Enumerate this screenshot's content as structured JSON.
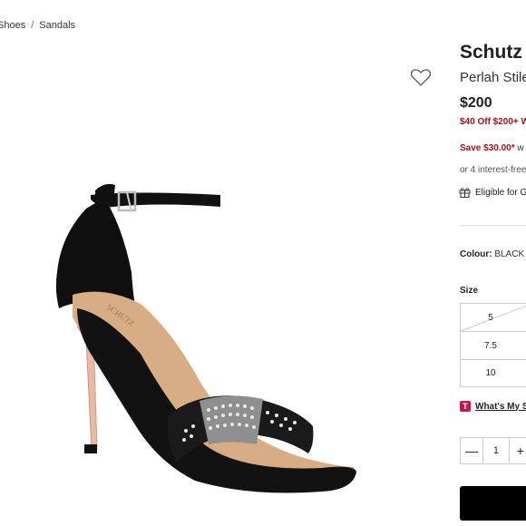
{
  "breadcrumb": [
    "Shoes",
    "Sandals"
  ],
  "breadcrumb_separator": "/",
  "product": {
    "brand": "Schutz",
    "name": "Perlah Stile",
    "price": "$200",
    "promo": "$40 Off $200+ W",
    "save_amount": "Save $30.00*",
    "save_suffix": " w",
    "installments": "or 4 interest-free",
    "gift": "Eligible for G",
    "colour_label": "Colour:",
    "colour_value": " BLACK",
    "size_label": "Size",
    "sizes": [
      "5",
      "7.5",
      "10"
    ],
    "whats_badge": "T",
    "whats_link": "What's My S",
    "quantity": "1",
    "qty_minus": "—",
    "qty_plus": "+"
  },
  "icons": {
    "wishlist": "heart-icon",
    "gift": "gift-icon"
  },
  "colors": {
    "promo_red": "#a3121a",
    "badge_pink": "#c6174b",
    "button_black": "#000000"
  }
}
